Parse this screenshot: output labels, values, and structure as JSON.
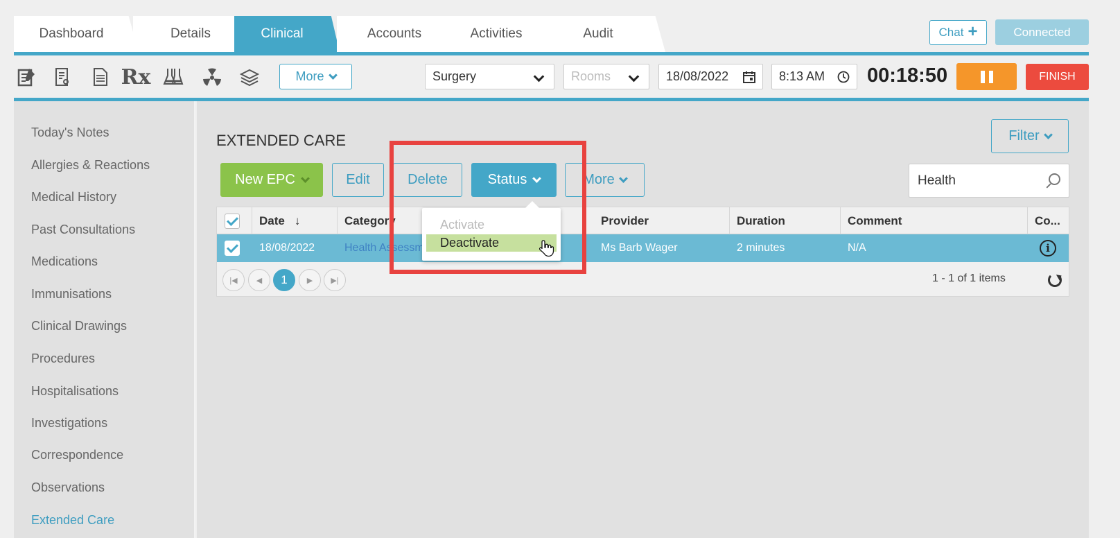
{
  "tabs": [
    {
      "label": "Dashboard",
      "active": false
    },
    {
      "label": "Details",
      "active": false
    },
    {
      "label": "Clinical",
      "active": true
    },
    {
      "label": "Accounts",
      "active": false
    },
    {
      "label": "Activities",
      "active": false
    },
    {
      "label": "Audit",
      "active": false
    }
  ],
  "header": {
    "chat_label": "Chat",
    "connected_label": "Connected"
  },
  "toolbar": {
    "icons": [
      "notes-icon",
      "prescription-pad-icon",
      "report-icon",
      "rx-icon",
      "lab-flask-icon",
      "radiation-icon",
      "stack-icon"
    ],
    "rx_label": "Rx",
    "more_label": "More",
    "location_value": "Surgery",
    "rooms_placeholder": "Rooms",
    "date_value": "18/08/2022",
    "time_value": "8:13 AM",
    "timer_value": "00:18:50",
    "finish_label": "FINISH"
  },
  "sidebar": {
    "items": [
      {
        "label": "Today's Notes"
      },
      {
        "label": "Allergies & Reactions"
      },
      {
        "label": "Medical History"
      },
      {
        "label": "Past Consultations"
      },
      {
        "label": "Medications"
      },
      {
        "label": "Immunisations"
      },
      {
        "label": "Clinical Drawings"
      },
      {
        "label": "Procedures"
      },
      {
        "label": "Hospitalisations"
      },
      {
        "label": "Investigations"
      },
      {
        "label": "Correspondence"
      },
      {
        "label": "Observations"
      },
      {
        "label": "Extended Care"
      }
    ],
    "active_item": "Extended Care"
  },
  "main": {
    "title": "EXTENDED CARE",
    "filter_label": "Filter",
    "new_epc_label": "New EPC",
    "edit_label": "Edit",
    "delete_label": "Delete",
    "status_label": "Status",
    "more_label": "More",
    "search_value": "Health"
  },
  "grid": {
    "columns": [
      "Date",
      "Category",
      "Provider",
      "Duration",
      "Comment",
      "Co..."
    ],
    "sort_indicator": "↓",
    "rows": [
      {
        "date": "18/08/2022",
        "category": "Health Assessme",
        "provider": "Ms Barb Wager",
        "duration": "2 minutes",
        "comment": "N/A",
        "selected": true
      }
    ],
    "pager": {
      "current_page": "1",
      "info": "1 - 1 of 1 items"
    }
  },
  "status_dropdown": {
    "items": [
      {
        "label": "Activate",
        "state": "disabled"
      },
      {
        "label": "Deactivate",
        "state": "hover"
      }
    ]
  },
  "colors": {
    "accent": "#44a7c8",
    "green": "#8bc34a",
    "orange": "#f5962a",
    "red": "#ec4b3e",
    "highlight": "#e8423f"
  }
}
